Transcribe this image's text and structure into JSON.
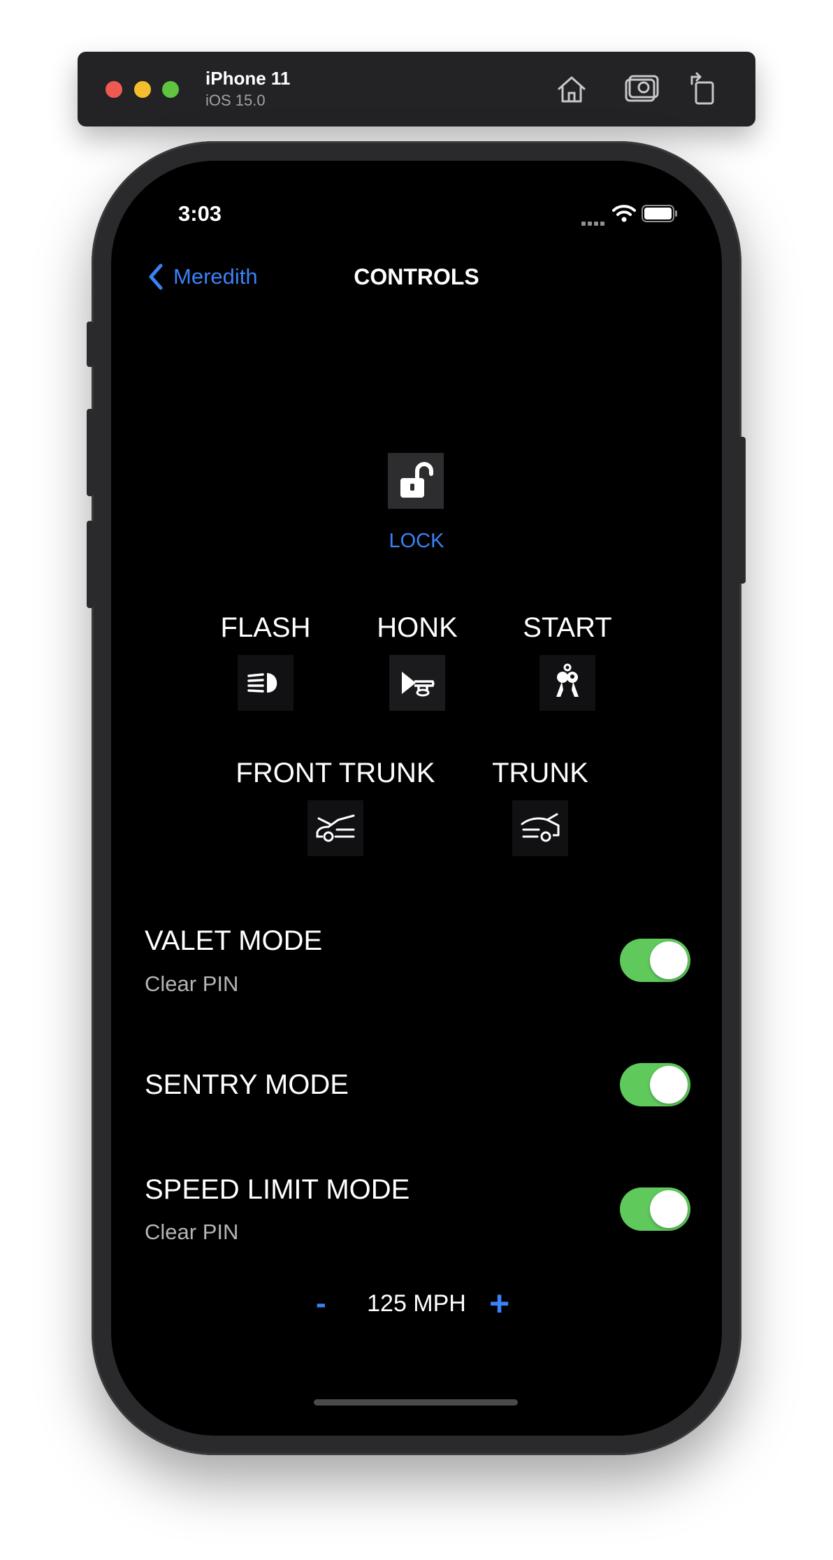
{
  "simulator": {
    "device_name": "iPhone 11",
    "os_version": "iOS 15.0",
    "icons": [
      "home-icon",
      "screenshot-icon",
      "rotate-icon"
    ]
  },
  "status_bar": {
    "time": "3:03",
    "icons": [
      "signal-icon",
      "wifi-icon",
      "battery-icon"
    ]
  },
  "nav": {
    "back_label": "Meredith",
    "title": "CONTROLS"
  },
  "lock": {
    "label": "LOCK",
    "icon": "unlocked-padlock-icon"
  },
  "controls_row1": [
    {
      "label": "FLASH",
      "icon": "headlight-icon"
    },
    {
      "label": "HONK",
      "icon": "horn-icon"
    },
    {
      "label": "START",
      "icon": "car-keys-icon"
    }
  ],
  "controls_row2": [
    {
      "label": "FRONT TRUNK",
      "icon": "front-trunk-icon"
    },
    {
      "label": "TRUNK",
      "icon": "rear-trunk-icon"
    }
  ],
  "modes": {
    "valet": {
      "title": "VALET MODE",
      "subtitle": "Clear PIN",
      "enabled": true
    },
    "sentry": {
      "title": "SENTRY MODE",
      "enabled": true
    },
    "speed_limit": {
      "title": "SPEED LIMIT MODE",
      "subtitle": "Clear PIN",
      "enabled": true
    }
  },
  "speed": {
    "minus_label": "-",
    "value": "125 MPH",
    "plus_label": "+"
  },
  "colors": {
    "accent": "#3a82f7",
    "toggle_on": "#5fc95c",
    "background": "#000000"
  }
}
